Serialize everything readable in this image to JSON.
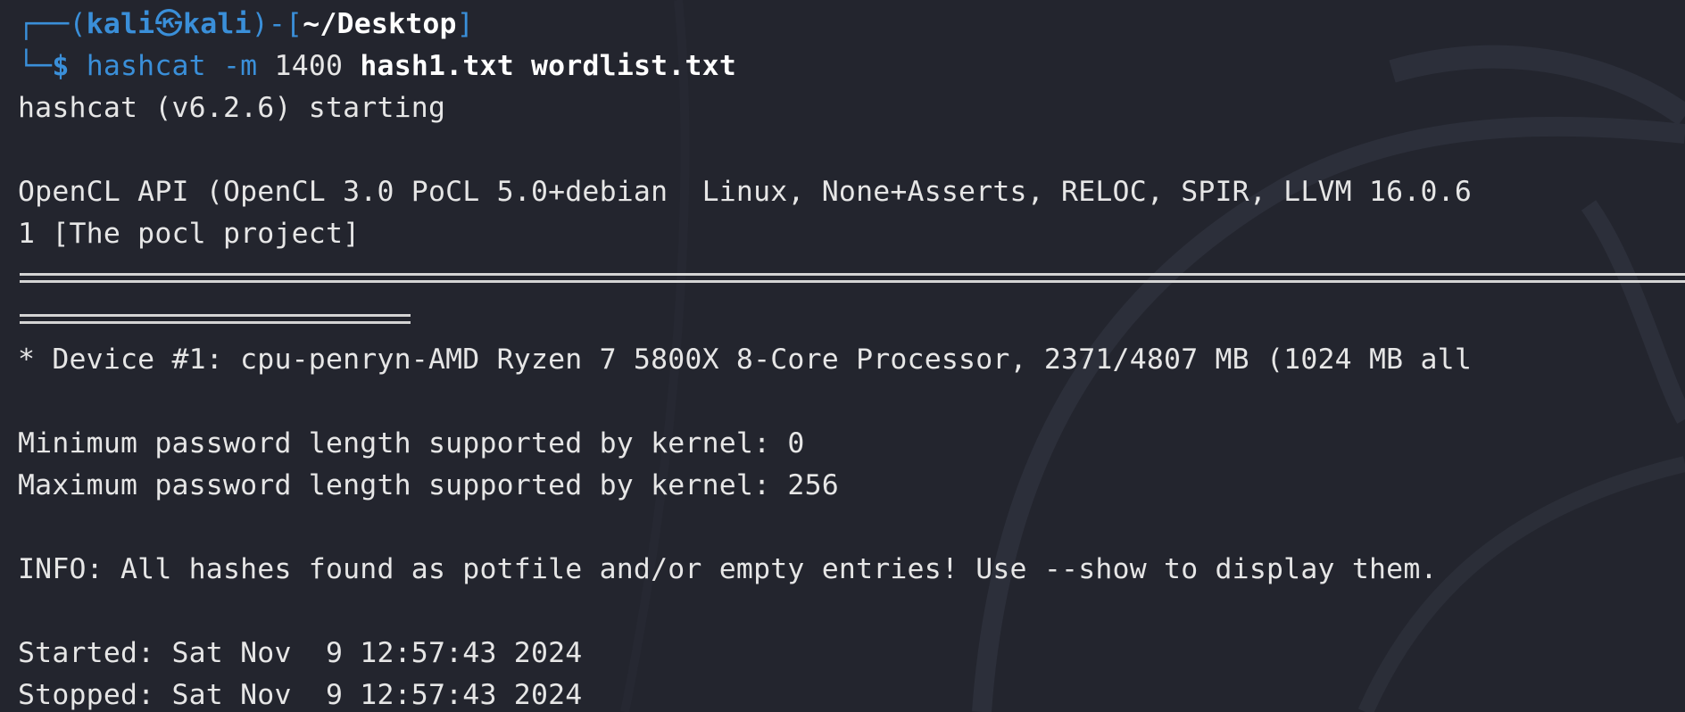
{
  "prompt": {
    "user": "kali",
    "skull": "㉿",
    "host": "kali",
    "cwd": "~/Desktop",
    "dollar": "$",
    "cmd_name": "hashcat",
    "cmd_flag": "-m",
    "cmd_mode": "1400",
    "cmd_args": "hash1.txt wordlist.txt"
  },
  "output": {
    "starting": "hashcat (v6.2.6) starting",
    "opencl_line1": "OpenCL API (OpenCL 3.0 PoCL 5.0+debian  Linux, None+Asserts, RELOC, SPIR, LLVM 16.0.6",
    "opencl_line2": "1 [The pocl project]",
    "device": "* Device #1: cpu-penryn-AMD Ryzen 7 5800X 8-Core Processor, 2371/4807 MB (1024 MB all",
    "min_len": "Minimum password length supported by kernel: 0",
    "max_len": "Maximum password length supported by kernel: 256",
    "info": "INFO: All hashes found as potfile and/or empty entries! Use --show to display them.",
    "started": "Started: Sat Nov  9 12:57:43 2024",
    "stopped": "Stopped: Sat Nov  9 12:57:43 2024"
  },
  "colors": {
    "background": "#23252e",
    "prompt_blue": "#3a8fd9",
    "text": "#e6e6e6"
  }
}
